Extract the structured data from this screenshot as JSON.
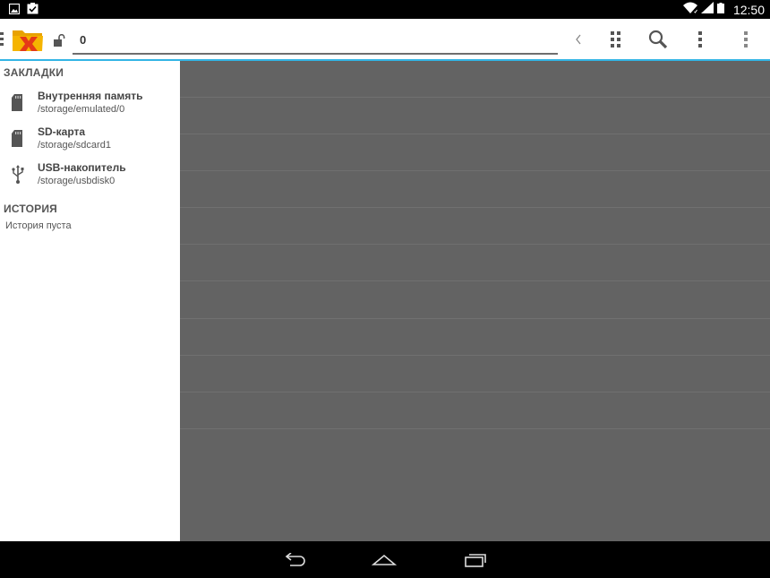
{
  "status_bar": {
    "time": "12:50",
    "icons": [
      "image-notification-icon",
      "task-complete-notification-icon",
      "wifi-icon",
      "signal-icon",
      "battery-icon"
    ]
  },
  "action_bar": {
    "path_value": "0",
    "icons": [
      "drawer-handle-icon",
      "app-logo-icon",
      "unlock-icon",
      "chevron-left-icon",
      "grid-dots-icon",
      "search-icon",
      "overflow-menu-icon",
      "more-vertical-icon"
    ]
  },
  "sidebar": {
    "bookmarks_header": "ЗАКЛАДКИ",
    "bookmarks": [
      {
        "title": "Внутренняя память",
        "path": "/storage/emulated/0",
        "icon": "sd-card-icon"
      },
      {
        "title": "SD-карта",
        "path": "/storage/sdcard1",
        "icon": "sd-card-icon"
      },
      {
        "title": "USB-накопитель",
        "path": "/storage/usbdisk0",
        "icon": "usb-icon"
      }
    ],
    "history_header": "ИСТОРИЯ",
    "history_empty": "История пуста"
  },
  "nav_bar": {
    "icons": [
      "back-icon",
      "home-icon",
      "recents-icon"
    ]
  },
  "colors": {
    "accent": "#33b5e5",
    "content_bg": "#636363",
    "logo_folder": "#f5b400",
    "logo_x": "#e53917"
  }
}
